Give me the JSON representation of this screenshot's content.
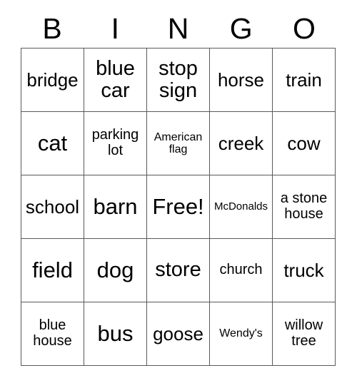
{
  "card": {
    "title": "BINGO",
    "header_letters": [
      "B",
      "I",
      "N",
      "G",
      "O"
    ],
    "columns": 5,
    "rows": 5,
    "border_color": "#5a5a5a",
    "background_color": "#ffffff",
    "text_color": "#000000",
    "free_space": "Free!",
    "free_space_position": "row3-col3",
    "cells": [
      {
        "text": "bridge",
        "size": "md",
        "row": 1,
        "col": 1,
        "column_letter": "B"
      },
      {
        "text": "blue car",
        "size": "lg",
        "row": 1,
        "col": 2,
        "column_letter": "I"
      },
      {
        "text": "stop sign",
        "size": "lg",
        "row": 1,
        "col": 3,
        "column_letter": "N"
      },
      {
        "text": "horse",
        "size": "md",
        "row": 1,
        "col": 4,
        "column_letter": "G"
      },
      {
        "text": "train",
        "size": "md",
        "row": 1,
        "col": 5,
        "column_letter": "O"
      },
      {
        "text": "cat",
        "size": "xl",
        "row": 2,
        "col": 1,
        "column_letter": "B"
      },
      {
        "text": "parking lot",
        "size": "sm",
        "row": 2,
        "col": 2,
        "column_letter": "I"
      },
      {
        "text": "American flag",
        "size": "xs",
        "row": 2,
        "col": 3,
        "column_letter": "N"
      },
      {
        "text": "creek",
        "size": "md",
        "row": 2,
        "col": 4,
        "column_letter": "G"
      },
      {
        "text": "cow",
        "size": "md",
        "row": 2,
        "col": 5,
        "column_letter": "O"
      },
      {
        "text": "school",
        "size": "md",
        "row": 3,
        "col": 1,
        "column_letter": "B"
      },
      {
        "text": "barn",
        "size": "xl",
        "row": 3,
        "col": 2,
        "column_letter": "I"
      },
      {
        "text": "Free!",
        "size": "xl",
        "row": 3,
        "col": 3,
        "column_letter": "N"
      },
      {
        "text": "McDonalds",
        "size": "xxs",
        "row": 3,
        "col": 4,
        "column_letter": "G"
      },
      {
        "text": "a stone house",
        "size": "sm",
        "row": 3,
        "col": 5,
        "column_letter": "O"
      },
      {
        "text": "field",
        "size": "xl",
        "row": 4,
        "col": 1,
        "column_letter": "B"
      },
      {
        "text": "dog",
        "size": "xl",
        "row": 4,
        "col": 2,
        "column_letter": "I"
      },
      {
        "text": "store",
        "size": "lg",
        "row": 4,
        "col": 3,
        "column_letter": "N"
      },
      {
        "text": "church",
        "size": "sm",
        "row": 4,
        "col": 4,
        "column_letter": "G"
      },
      {
        "text": "truck",
        "size": "md",
        "row": 4,
        "col": 5,
        "column_letter": "O"
      },
      {
        "text": "blue house",
        "size": "sm",
        "row": 5,
        "col": 1,
        "column_letter": "B"
      },
      {
        "text": "bus",
        "size": "xl",
        "row": 5,
        "col": 2,
        "column_letter": "I"
      },
      {
        "text": "goose",
        "size": "md",
        "row": 5,
        "col": 3,
        "column_letter": "N"
      },
      {
        "text": "Wendy's",
        "size": "xs",
        "row": 5,
        "col": 4,
        "column_letter": "G"
      },
      {
        "text": "willow tree",
        "size": "sm",
        "row": 5,
        "col": 5,
        "column_letter": "O"
      }
    ]
  }
}
